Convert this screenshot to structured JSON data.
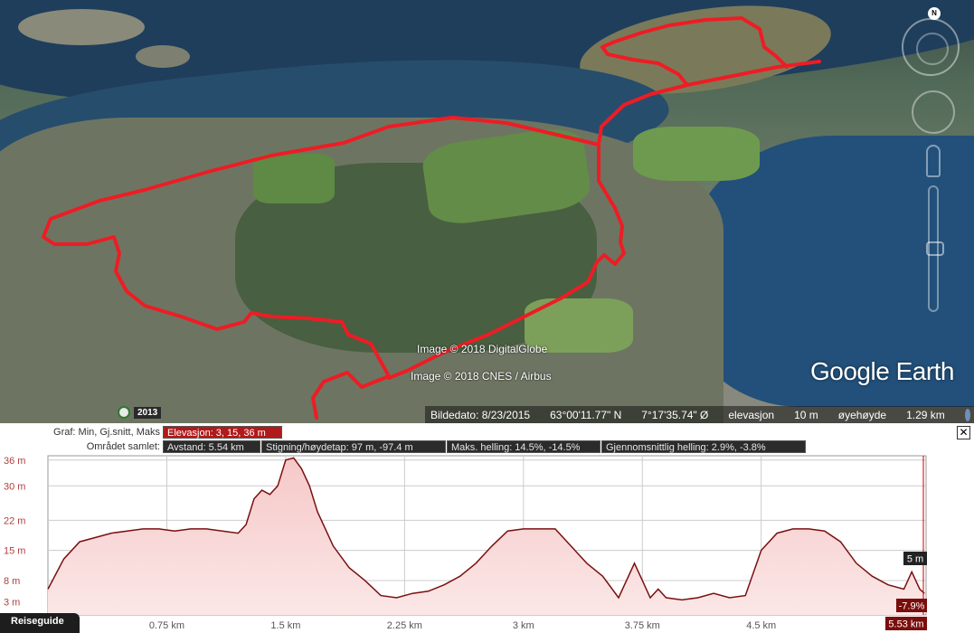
{
  "map": {
    "credits": [
      "Image © 2018 DigitalGlobe",
      "Image © 2018 CNES / Airbus"
    ],
    "logo": "Google Earth",
    "year": "2013",
    "compass_letter": "N",
    "status": {
      "date": "Bildedato: 8/23/2015",
      "lat": "63°00'11.77\" N",
      "lon": "7°17'35.74\" Ø",
      "elev_label": "elevasjon",
      "elev_value": "10 m",
      "eye_label": "øyehøyde",
      "eye_value": "1.29 km"
    },
    "track_color": "#ee1c24"
  },
  "profile": {
    "row1_label": "Graf: Min, Gj.snitt, Maks",
    "row1_value": "Elevasjon: 3, 15, 36 m",
    "row2_label": "Området samlet:",
    "stats": [
      "Avstand: 5.54 km",
      "Stigning/høydetap: 97 m, -97.4 m",
      "Maks. helling: 14.5%, -14.5%",
      "Gjennomsnittlig helling: 2.9%, -3.8%"
    ],
    "close_glyph": "✕",
    "tab_label": "Reiseguide",
    "cursor": {
      "elev": "5 m",
      "slope": "-7.9%",
      "dist": "5.53 km"
    }
  },
  "chart_data": {
    "type": "area",
    "xlabel": "",
    "ylabel": "",
    "xlim": [
      0,
      5.54
    ],
    "ylim": [
      0,
      37
    ],
    "y_ticks": [
      "3 m",
      "8 m",
      "15 m",
      "22 m",
      "30 m",
      "36 m"
    ],
    "y_tick_values": [
      3,
      8,
      15,
      22,
      30,
      36
    ],
    "x_ticks": [
      "0.75 km",
      "1.5 km",
      "2.25 km",
      "3 km",
      "3.75 km",
      "4.5 km"
    ],
    "x_tick_values": [
      0.75,
      1.5,
      2.25,
      3,
      3.75,
      4.5
    ],
    "x": [
      0,
      0.1,
      0.2,
      0.3,
      0.4,
      0.5,
      0.6,
      0.7,
      0.8,
      0.9,
      1.0,
      1.1,
      1.2,
      1.25,
      1.3,
      1.35,
      1.4,
      1.45,
      1.5,
      1.55,
      1.6,
      1.65,
      1.7,
      1.8,
      1.9,
      2.0,
      2.1,
      2.2,
      2.3,
      2.4,
      2.5,
      2.6,
      2.7,
      2.8,
      2.9,
      3.0,
      3.1,
      3.2,
      3.3,
      3.4,
      3.5,
      3.6,
      3.7,
      3.75,
      3.8,
      3.85,
      3.9,
      4.0,
      4.1,
      4.2,
      4.3,
      4.4,
      4.5,
      4.6,
      4.7,
      4.8,
      4.9,
      5.0,
      5.1,
      5.2,
      5.3,
      5.4,
      5.45,
      5.5,
      5.53
    ],
    "y": [
      6,
      13,
      17,
      18,
      19,
      19.5,
      20,
      20,
      19.5,
      20,
      20,
      19.5,
      19,
      21,
      27,
      29,
      28,
      30,
      36,
      36.5,
      34,
      30,
      24,
      16,
      11,
      8,
      4.5,
      4,
      5,
      5.5,
      7,
      9,
      12,
      16,
      19.5,
      20,
      20,
      20,
      16,
      12,
      9,
      4,
      12,
      8,
      4,
      6,
      4,
      3.5,
      4,
      5,
      4,
      4.5,
      15,
      19,
      20,
      20,
      19.5,
      17,
      12,
      9,
      7,
      6,
      10,
      6,
      5
    ]
  }
}
